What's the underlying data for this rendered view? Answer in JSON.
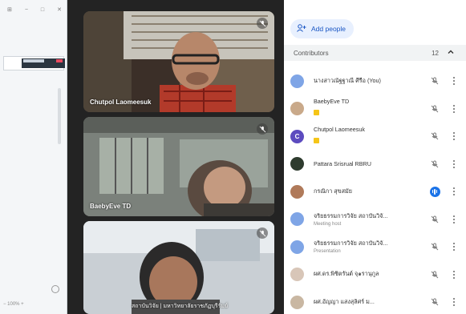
{
  "left_strip": {
    "controls": [
      "⊞",
      "−",
      "□",
      "✕"
    ],
    "zoom": "−  100%  +"
  },
  "videos": [
    {
      "label": "Chutpol Laomeesuk",
      "muted": true
    },
    {
      "label": "BaebyEve TD",
      "muted": true
    },
    {
      "label": "สถาบันวิจัย | มหาวิทยาลัยราชภัฏบุรีรัมย์",
      "muted": true
    }
  ],
  "panel": {
    "add_people_label": "Add people",
    "contributors_label": "Contributors",
    "contributors_count": "12",
    "participants": [
      {
        "name": "นางสาวณัฐฐาณี ศีรือ (You)",
        "sub": "",
        "avatar_color": "#7fa5e6",
        "avatar_text": "",
        "badge": false,
        "speaking": false
      },
      {
        "name": "BaebyEve TD",
        "sub": "",
        "avatar_color": "#c9a98a",
        "avatar_text": "",
        "badge": true,
        "speaking": false
      },
      {
        "name": "Chutpol Laomeesuk",
        "sub": "",
        "avatar_color": "#5c4bbf",
        "avatar_text": "C",
        "badge": true,
        "speaking": false
      },
      {
        "name": "Pattara Srisrual RBRU",
        "sub": "",
        "avatar_color": "#2e3b2e",
        "avatar_text": "",
        "badge": false,
        "speaking": false
      },
      {
        "name": "กรณิกา สุขสมัย",
        "sub": "",
        "avatar_color": "#b07a5a",
        "avatar_text": "",
        "badge": false,
        "speaking": true
      },
      {
        "name": "จริยธรรมการวิจัย สถาบันวิจั...",
        "sub": "Meeting host",
        "avatar_color": "#7fa5e6",
        "avatar_text": "",
        "badge": false,
        "speaking": false
      },
      {
        "name": "จริยธรรมการวิจัย สถาบันวิจั...",
        "sub": "Presentation",
        "avatar_color": "#7fa5e6",
        "avatar_text": "",
        "badge": false,
        "speaking": false
      },
      {
        "name": "ผศ.ดร.พิชิตรันต์ จุ๑รานุกูล",
        "sub": "",
        "avatar_color": "#d8c6b8",
        "avatar_text": "",
        "badge": false,
        "speaking": false
      },
      {
        "name": "ผศ.อัญญา แสงสุลิศร์ ม...",
        "sub": "",
        "avatar_color": "#c9b7a2",
        "avatar_text": "",
        "badge": false,
        "speaking": false
      }
    ]
  }
}
